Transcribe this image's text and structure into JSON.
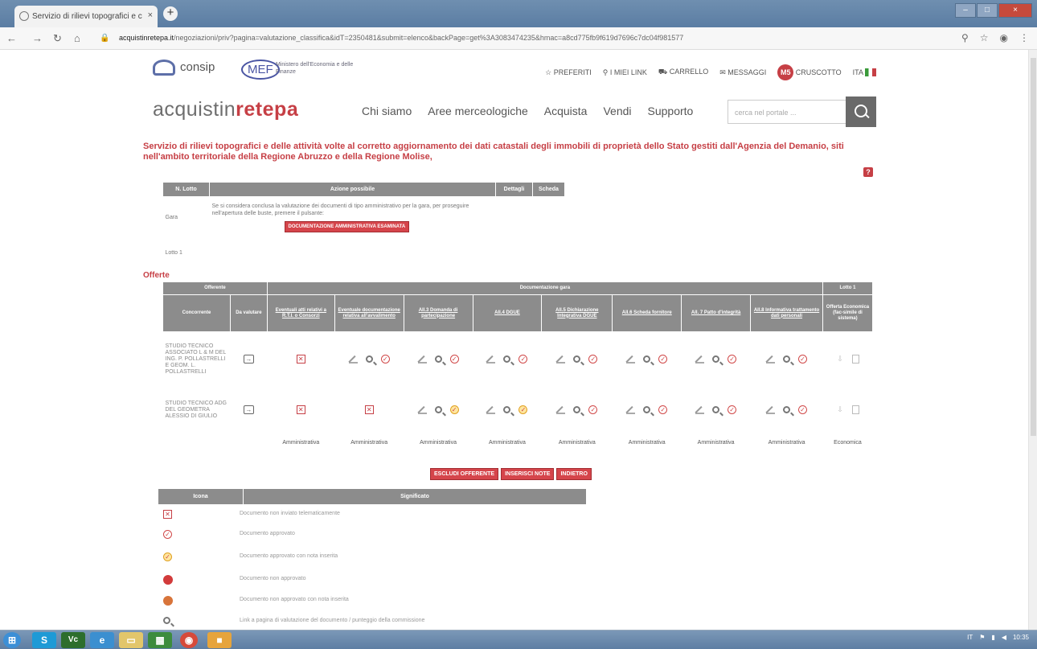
{
  "browser": {
    "tab_title": "Servizio di rilievi topografici e c",
    "url_host": "acquistinretepa.it",
    "url_path": "/negoziazioni/priv?pagina=valutazione_classifica&idT=2350481&submit=elenco&backPage=get%3A3083474235&hmac=a8cd775fb9f619d7696c7dc04f981577"
  },
  "header": {
    "consip": "consip",
    "mef": "MEF",
    "mef_sub": "Ministero dell'Economia e delle Finanze",
    "toplinks": [
      "PREFERITI",
      "I MIEI LINK",
      "CARRELLO",
      "MESSAGGI"
    ],
    "avatar": "M5",
    "cruscotto": "CRUSCOTTO",
    "lang": "ITA",
    "brand_a": "acquistin",
    "brand_b": "rete",
    "brand_c": "pa",
    "menu": [
      "Chi siamo",
      "Aree merceologiche",
      "Acquista",
      "Vendi",
      "Supporto"
    ],
    "search_placeholder": "cerca nel portale ..."
  },
  "page_title": "Servizio di rilievi topografici e delle attività volte al corretto aggiornamento dei dati catastali degli immobili di proprietà dello Stato gestiti dall'Agenzia del Demanio, siti nell'ambito territoriale della Regione Abruzzo e della Regione Molise,",
  "lotti_table": {
    "headers": [
      "N. Lotto",
      "Azione possibile",
      "Dettagli",
      "Scheda"
    ],
    "gara_label": "Gara",
    "gara_text": "Se si considera conclusa la valutazione dei documenti di tipo amministrativo per la gara, per proseguire nell'apertura delle buste, premere il pulsante:",
    "gara_button": "DOCUMENTAZIONE AMMINISTRATIVA ESAMINATA",
    "lotto_label": "Lotto 1"
  },
  "offerte_label": "Offerte",
  "offerte_table": {
    "group_headers": [
      "Offerente",
      "Documentazione gara",
      "Lotto 1"
    ],
    "headers": [
      "Concorrente",
      "Da valutare",
      "Eventuali atti relativi a R.T.I. o Consorzi",
      "Eventuale documentazione relativa all'avvalimento",
      "All.3 Domanda di partecipazione",
      "All.4 DGUE",
      "All.5 Dichiarazione Integrativa DGUE",
      "All.6 Scheda fornitore",
      "All. 7 Patto d'integrità",
      "All.8 Informativa trattamento dati personali",
      "Offerta Economica (fac-simile di sistema)"
    ],
    "rows": [
      {
        "name": "STUDIO TECNICO ASSOCIATO L & M DEL ING. P. POLLASTRELLI E GEOM. L. POLLASTRELLI"
      },
      {
        "name": "STUDIO TECNICO ADG DEL GEOMETRA ALESSIO DI GIULIO"
      }
    ],
    "footer": [
      "Amministrativa",
      "Amministrativa",
      "Amministrativa",
      "Amministrativa",
      "Amministrativa",
      "Amministrativa",
      "Amministrativa",
      "Amministrativa",
      "Economica"
    ]
  },
  "action_buttons": [
    "ESCLUDI OFFERENTE",
    "INSERISCI NOTE",
    "INDIETRO"
  ],
  "legend": {
    "headers": [
      "Icona",
      "Significato"
    ],
    "items": [
      "Documento non inviato telematicamente",
      "Documento approvato",
      "Documento approvato con nota inserita",
      "Documento non approvato",
      "Documento non approvato con nota inserita",
      "Link a pagina di valutazione del documento / punteggio della commissione"
    ]
  },
  "taskbar": {
    "time": "10:35",
    "tray_lang": "IT"
  },
  "colors": {
    "accent": "#c63f45",
    "header_gray": "#8c8c8c"
  }
}
